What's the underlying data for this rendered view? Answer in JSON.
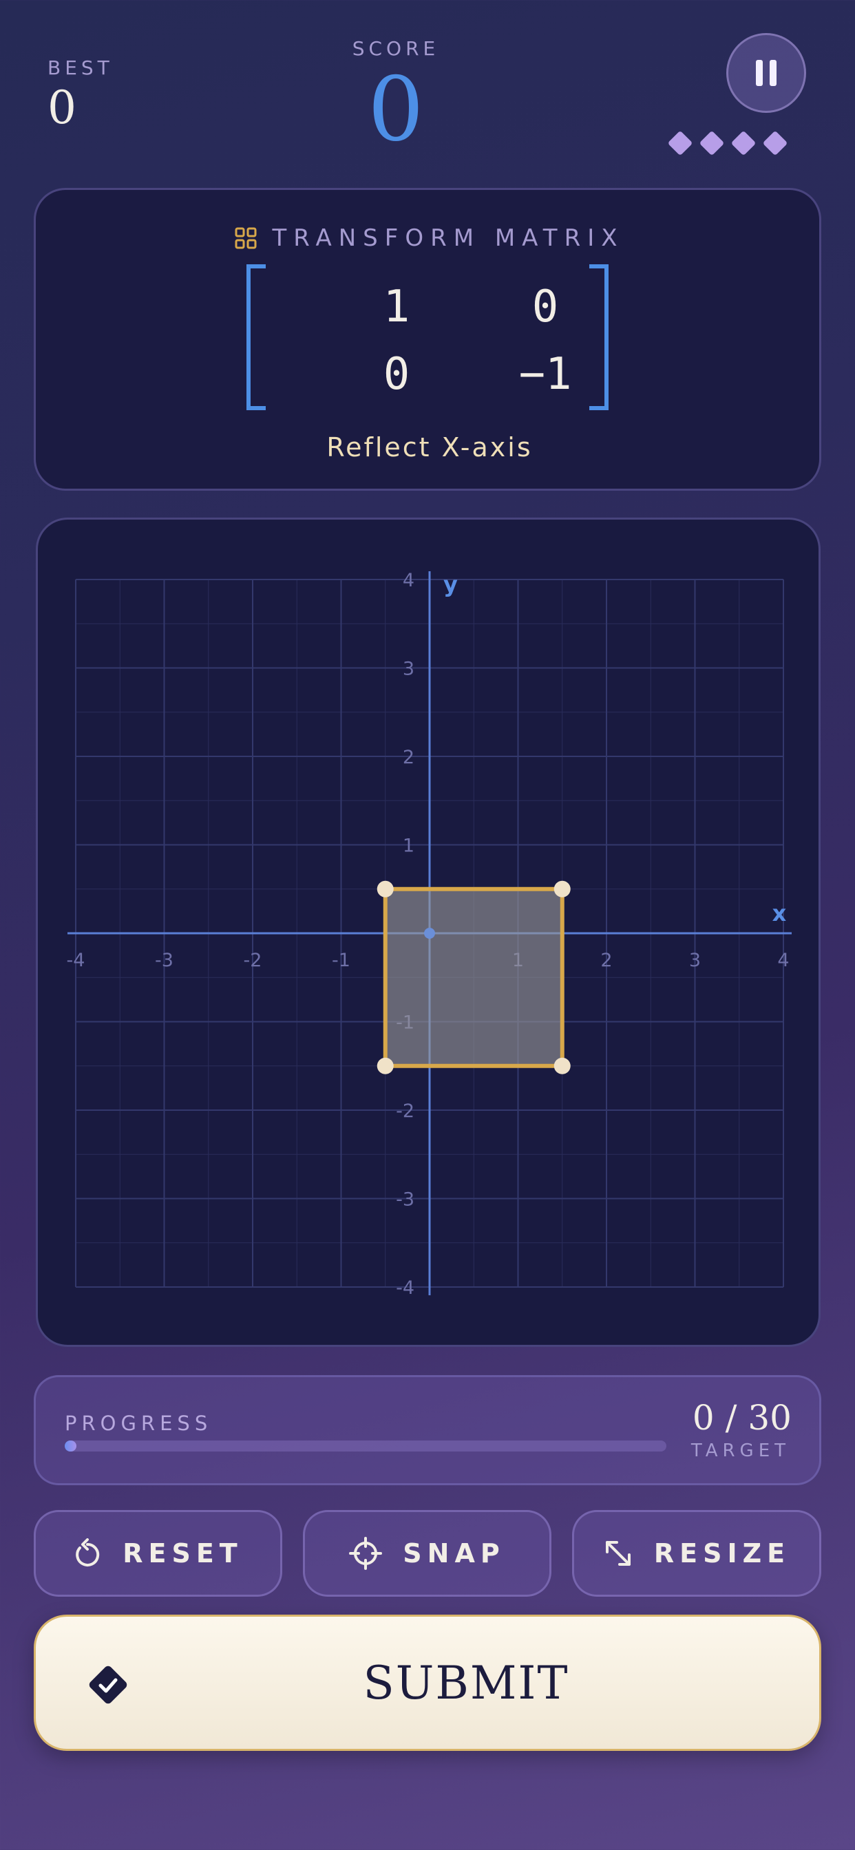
{
  "header": {
    "best_label": "BEST",
    "best_value": "0",
    "score_label": "SCORE",
    "score_value": "0",
    "lives": 4
  },
  "matrix": {
    "title": "TRANSFORM MATRIX",
    "values": [
      [
        "1",
        "0"
      ],
      [
        "0",
        "−1"
      ]
    ],
    "caption": "Reflect X-axis"
  },
  "grid": {
    "x_axis_label": "x",
    "y_axis_label": "y",
    "range": [
      -4,
      4
    ],
    "x_ticks": [
      "-4",
      "-3",
      "-2",
      "-1",
      "1",
      "2",
      "3",
      "4"
    ],
    "y_ticks": [
      "4",
      "3",
      "2",
      "1",
      "-1",
      "-2",
      "-3",
      "-4"
    ],
    "shape": {
      "x_min": -0.5,
      "x_max": 1.5,
      "y_min": -1.5,
      "y_max": 0.5
    }
  },
  "progress": {
    "label": "PROGRESS",
    "count": "0 / 30",
    "target_label": "TARGET",
    "fraction": 0.02
  },
  "tools": {
    "reset_label": "RESET",
    "snap_label": "SNAP",
    "resize_label": "RESIZE"
  },
  "submit": {
    "label": "SUBMIT"
  },
  "colors": {
    "accent_blue": "#4d8fe6",
    "shape_outline": "#d8a84a",
    "handle": "#f0e2c8"
  }
}
